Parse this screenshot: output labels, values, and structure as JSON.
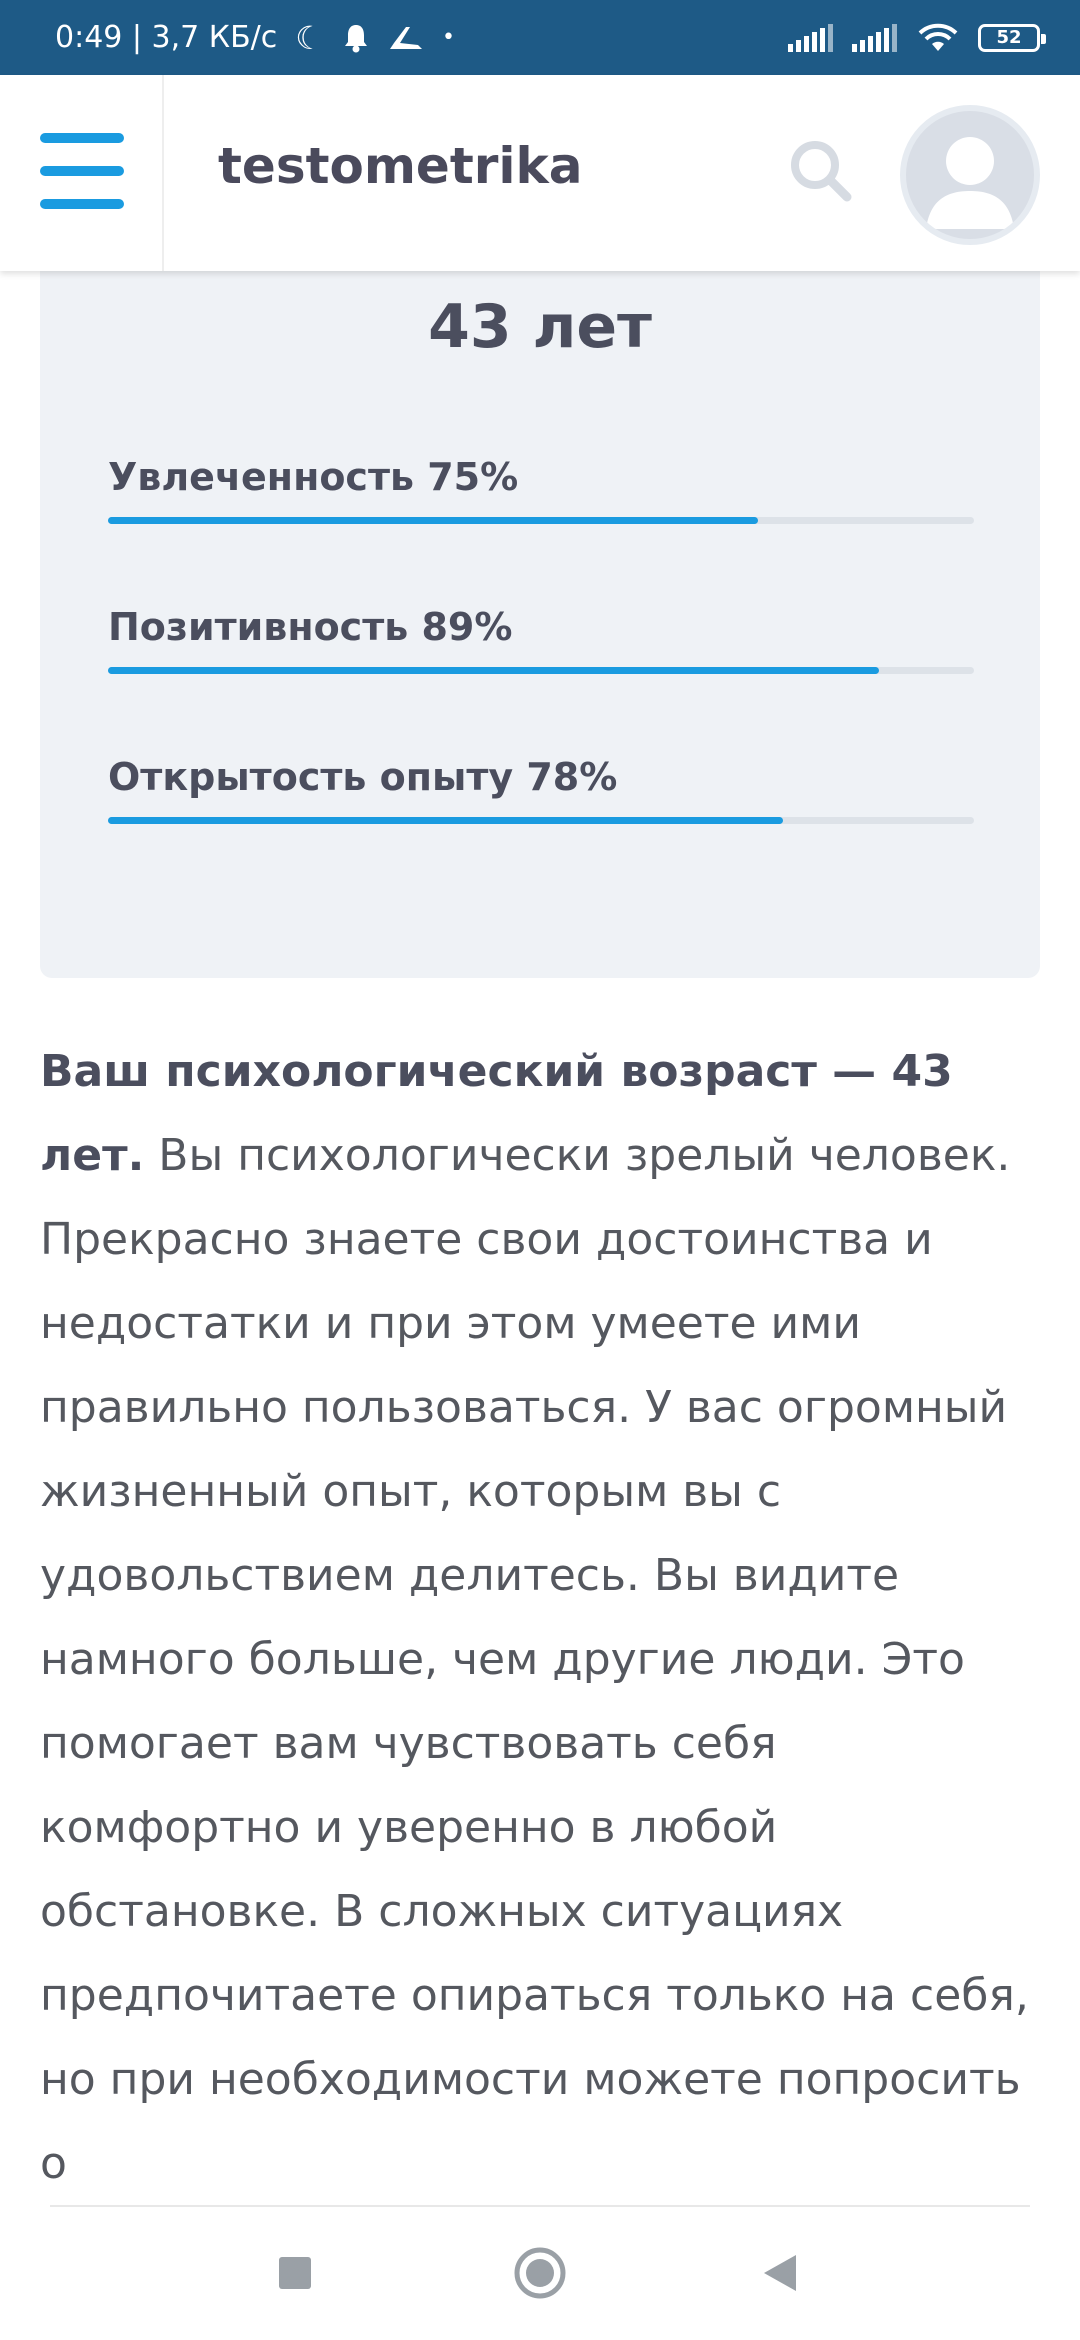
{
  "status_bar": {
    "time_speed": "0:49 | 3,7 КБ/с",
    "icons": [
      "moon-icon",
      "bell-icon",
      "bird-icon",
      "dot-icon",
      "signal-icon",
      "signal-icon",
      "wifi-icon",
      "battery-icon"
    ],
    "battery": "52"
  },
  "header": {
    "logo": "testometrika",
    "accent_color": "#1a9be0",
    "icons": [
      "menu-icon",
      "search-icon",
      "avatar-icon"
    ]
  },
  "result_card": {
    "age": "43 лет",
    "metrics": [
      {
        "label": "Увлеченность 75%",
        "value": 0.75
      },
      {
        "label": "Позитивность 89%",
        "value": 0.89
      },
      {
        "label": "Открытость опыту 78%",
        "value": 0.78
      }
    ]
  },
  "article": {
    "bold_intro": "Ваш психологический возраст — 43 лет.",
    "text": " Вы психологически зрелый человек. Прекрасно знаете свои достоинства и недостатки и при этом умеете ими правильно пользоваться. У вас огромный жизненный опыт, которым вы с удовольствием делитесь. Вы видите намного больше, чем другие люди. Это помогает вам чувствовать себя комфортно и уверенно в любой обстановке. В сложных ситуациях предпочитаете опираться только на себя, но при необходимости можете попросить о"
  },
  "nav_bar": {
    "buttons": [
      "recents-button",
      "home-button",
      "back-button"
    ]
  }
}
